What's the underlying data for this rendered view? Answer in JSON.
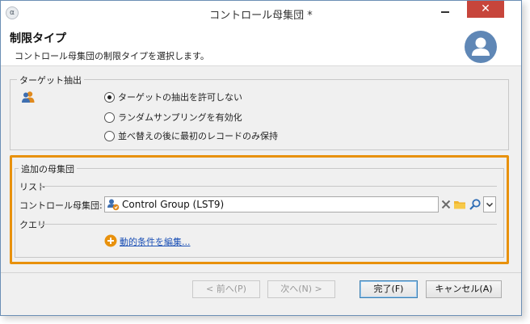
{
  "window": {
    "title": "コントロール母集団 *",
    "close_label": "✕",
    "app_icon_label": "α"
  },
  "header": {
    "title": "制限タイプ",
    "subtitle": "コントロール母集団の制限タイプを選択します。"
  },
  "target_extraction": {
    "legend": "ターゲット抽出",
    "options": [
      {
        "label": "ターゲットの抽出を許可しない",
        "checked": true
      },
      {
        "label": "ランダムサンプリングを有効化",
        "checked": false
      },
      {
        "label": "並べ替えの後に最初のレコードのみ保持",
        "checked": false
      }
    ]
  },
  "additional_population": {
    "legend": "追加の母集団",
    "list_section": "リスト",
    "control_group_label": "コントロール母集団:",
    "control_group_value": "Control Group (LST9)",
    "query_section": "クエリ",
    "edit_link": "動的条件を編集..."
  },
  "buttons": {
    "back": "< 前へ(P)",
    "next": "次へ(N) >",
    "finish": "完了(F)",
    "cancel": "キャンセル(A)"
  },
  "colors": {
    "highlight_border": "#e8910c",
    "link": "#1a4fb5",
    "close_button": "#c7453b",
    "avatar": "#5f87b6"
  }
}
